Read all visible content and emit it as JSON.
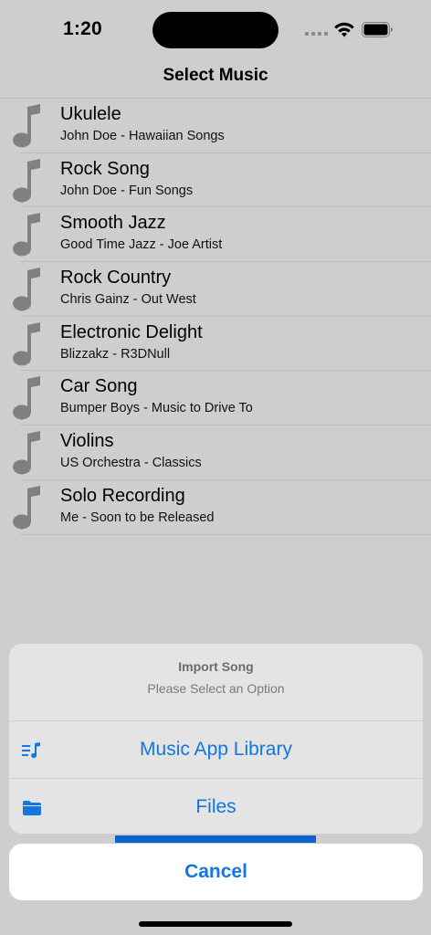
{
  "status_bar": {
    "time": "1:20"
  },
  "nav": {
    "title": "Select Music"
  },
  "songs": [
    {
      "title": "Ukulele",
      "subtitle": "John Doe - Hawaiian Songs"
    },
    {
      "title": "Rock Song",
      "subtitle": "John Doe - Fun Songs"
    },
    {
      "title": "Smooth Jazz",
      "subtitle": "Good Time Jazz - Joe Artist"
    },
    {
      "title": "Rock Country",
      "subtitle": "Chris Gainz - Out West"
    },
    {
      "title": "Electronic Delight",
      "subtitle": "Blizzakz - R3DNull"
    },
    {
      "title": "Car Song",
      "subtitle": "Bumper Boys - Music to Drive To"
    },
    {
      "title": "Violins",
      "subtitle": "US Orchestra - Classics"
    },
    {
      "title": "Solo Recording",
      "subtitle": "Me - Soon to be Released"
    }
  ],
  "action_sheet": {
    "title": "Import Song",
    "message": "Please Select an Option",
    "options": [
      {
        "label": "Music App Library",
        "icon": "music-list-icon"
      },
      {
        "label": "Files",
        "icon": "folder-icon"
      }
    ],
    "cancel_label": "Cancel"
  },
  "colors": {
    "accent": "#1477e0",
    "icon_gray": "#808080",
    "background": "#cecece"
  }
}
